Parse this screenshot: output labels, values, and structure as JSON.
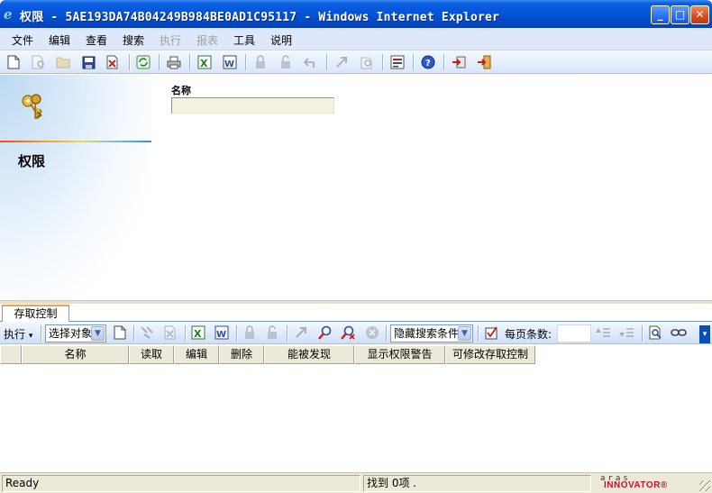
{
  "window": {
    "title": "权限 - 5AE193DA74B04249B984BE0AD1C95117 - Windows Internet Explorer",
    "controls": {
      "minimize": "_",
      "maximize": "□",
      "close": "✕"
    }
  },
  "menubar": {
    "items": [
      {
        "label": "文件",
        "enabled": true
      },
      {
        "label": "编辑",
        "enabled": true
      },
      {
        "label": "查看",
        "enabled": true
      },
      {
        "label": "搜索",
        "enabled": true
      },
      {
        "label": "执行",
        "enabled": false
      },
      {
        "label": "报表",
        "enabled": false
      },
      {
        "label": "工具",
        "enabled": true
      },
      {
        "label": "说明",
        "enabled": true
      }
    ]
  },
  "toolbar": {
    "icons": [
      "new-document-icon",
      "print-preview-icon",
      "open-folder-icon",
      "save-icon",
      "delete-icon",
      "refresh-icon",
      "print-icon",
      "excel-export-icon",
      "word-export-icon",
      "lock-icon",
      "unlock-icon",
      "undo-icon",
      "promote-icon",
      "lifecycle-icon",
      "workflow-icon",
      "help-icon",
      "close-window-icon",
      "exit-icon"
    ]
  },
  "form": {
    "section_title": "权限",
    "name_label": "名称",
    "name_value": ""
  },
  "relationships": {
    "tab_label": "存取控制",
    "execute_label": "执行",
    "execute_arrow": "▾",
    "select_object": "选择对象",
    "search_mode": "隐藏搜索条件",
    "page_size_label": "每页条数:",
    "page_size_value": "",
    "columns": [
      {
        "label": ""
      },
      {
        "label": "名称"
      },
      {
        "label": "读取"
      },
      {
        "label": "编辑"
      },
      {
        "label": "删除"
      },
      {
        "label": "能被发现"
      },
      {
        "label": "显示权限警告"
      },
      {
        "label": "可修改存取控制"
      }
    ]
  },
  "statusbar": {
    "status": "Ready",
    "found": "找到 0项 .",
    "brand_top": "aras",
    "brand_main": "INNOVATOR®"
  },
  "colors": {
    "titlebar": "#0653d6",
    "menubar": "#dde8f9",
    "input_bg": "#f5f3df",
    "tab_accent": "#f4a34a",
    "brand_red": "#c8102e"
  }
}
